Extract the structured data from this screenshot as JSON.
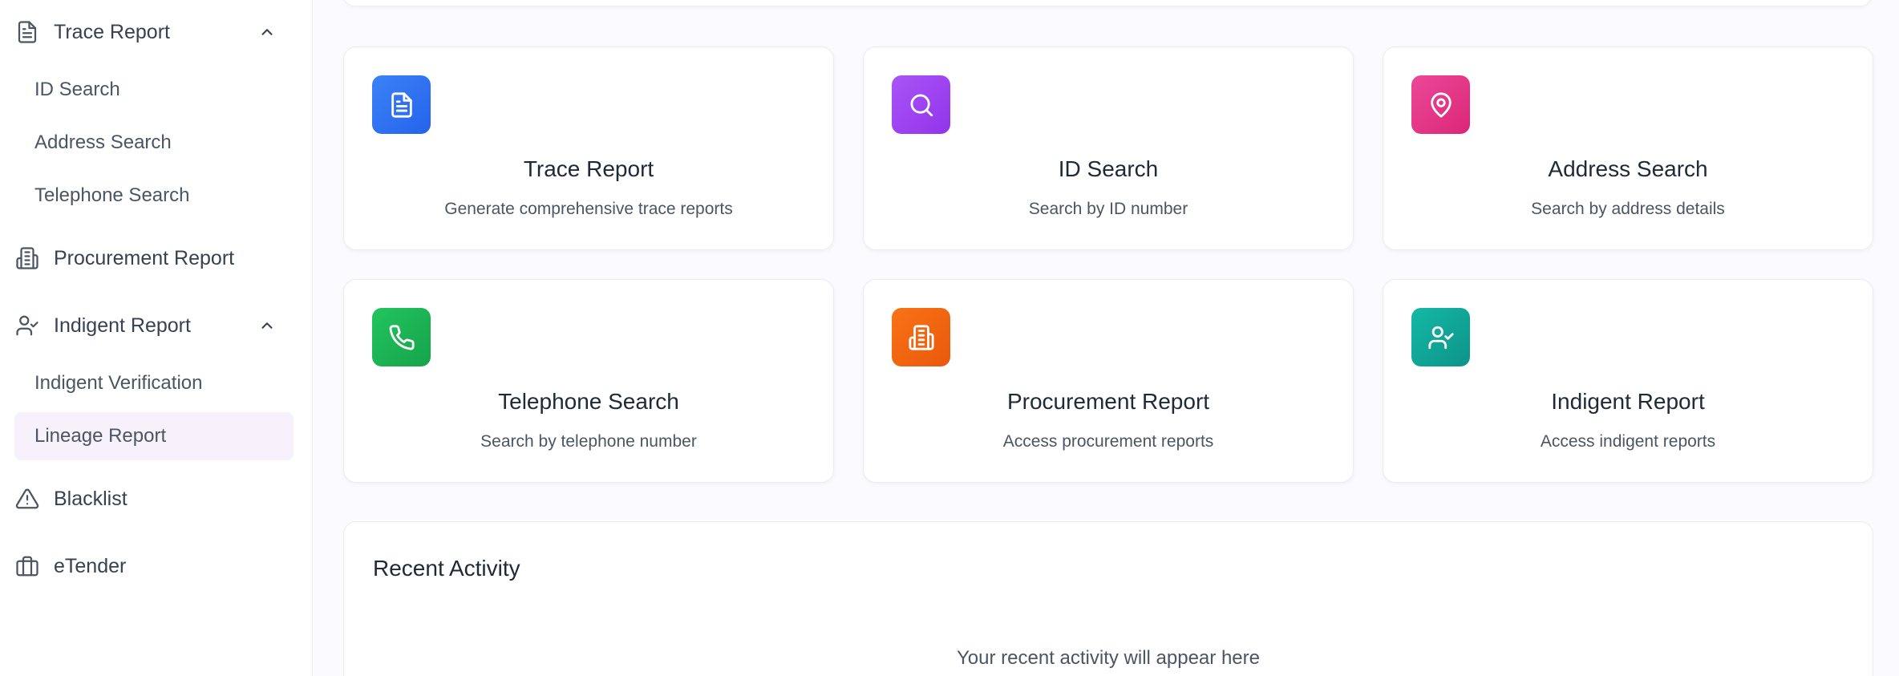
{
  "sidebar": {
    "trace_report": {
      "label": "Trace Report",
      "icon": "file-text-icon"
    },
    "trace_items": [
      {
        "label": "ID Search"
      },
      {
        "label": "Address Search"
      },
      {
        "label": "Telephone Search"
      }
    ],
    "procurement_report": {
      "label": "Procurement Report",
      "icon": "building-icon"
    },
    "indigent_report": {
      "label": "Indigent Report",
      "icon": "user-check-icon"
    },
    "indigent_items": [
      {
        "label": "Indigent Verification"
      },
      {
        "label": "Lineage Report",
        "active": true
      }
    ],
    "blacklist": {
      "label": "Blacklist",
      "icon": "warning-triangle-icon"
    },
    "etender": {
      "label": "eTender",
      "icon": "briefcase-icon"
    }
  },
  "cards": [
    {
      "title": "Trace Report",
      "description": "Generate comprehensive trace reports",
      "icon": "file-text-icon",
      "color": "#3b82f6"
    },
    {
      "title": "ID Search",
      "description": "Search by ID number",
      "icon": "search-icon",
      "color": "#a855f7"
    },
    {
      "title": "Address Search",
      "description": "Search by address details",
      "icon": "map-pin-icon",
      "color": "#ec4899"
    },
    {
      "title": "Telephone Search",
      "description": "Search by telephone number",
      "icon": "phone-icon",
      "color": "#22c55e"
    },
    {
      "title": "Procurement Report",
      "description": "Access procurement reports",
      "icon": "building-icon",
      "color": "#f97316"
    },
    {
      "title": "Indigent Report",
      "description": "Access indigent reports",
      "icon": "user-check-icon",
      "color": "#14b8a6"
    }
  ],
  "recent_activity": {
    "title": "Recent Activity",
    "empty_text": "Your recent activity will appear here"
  }
}
